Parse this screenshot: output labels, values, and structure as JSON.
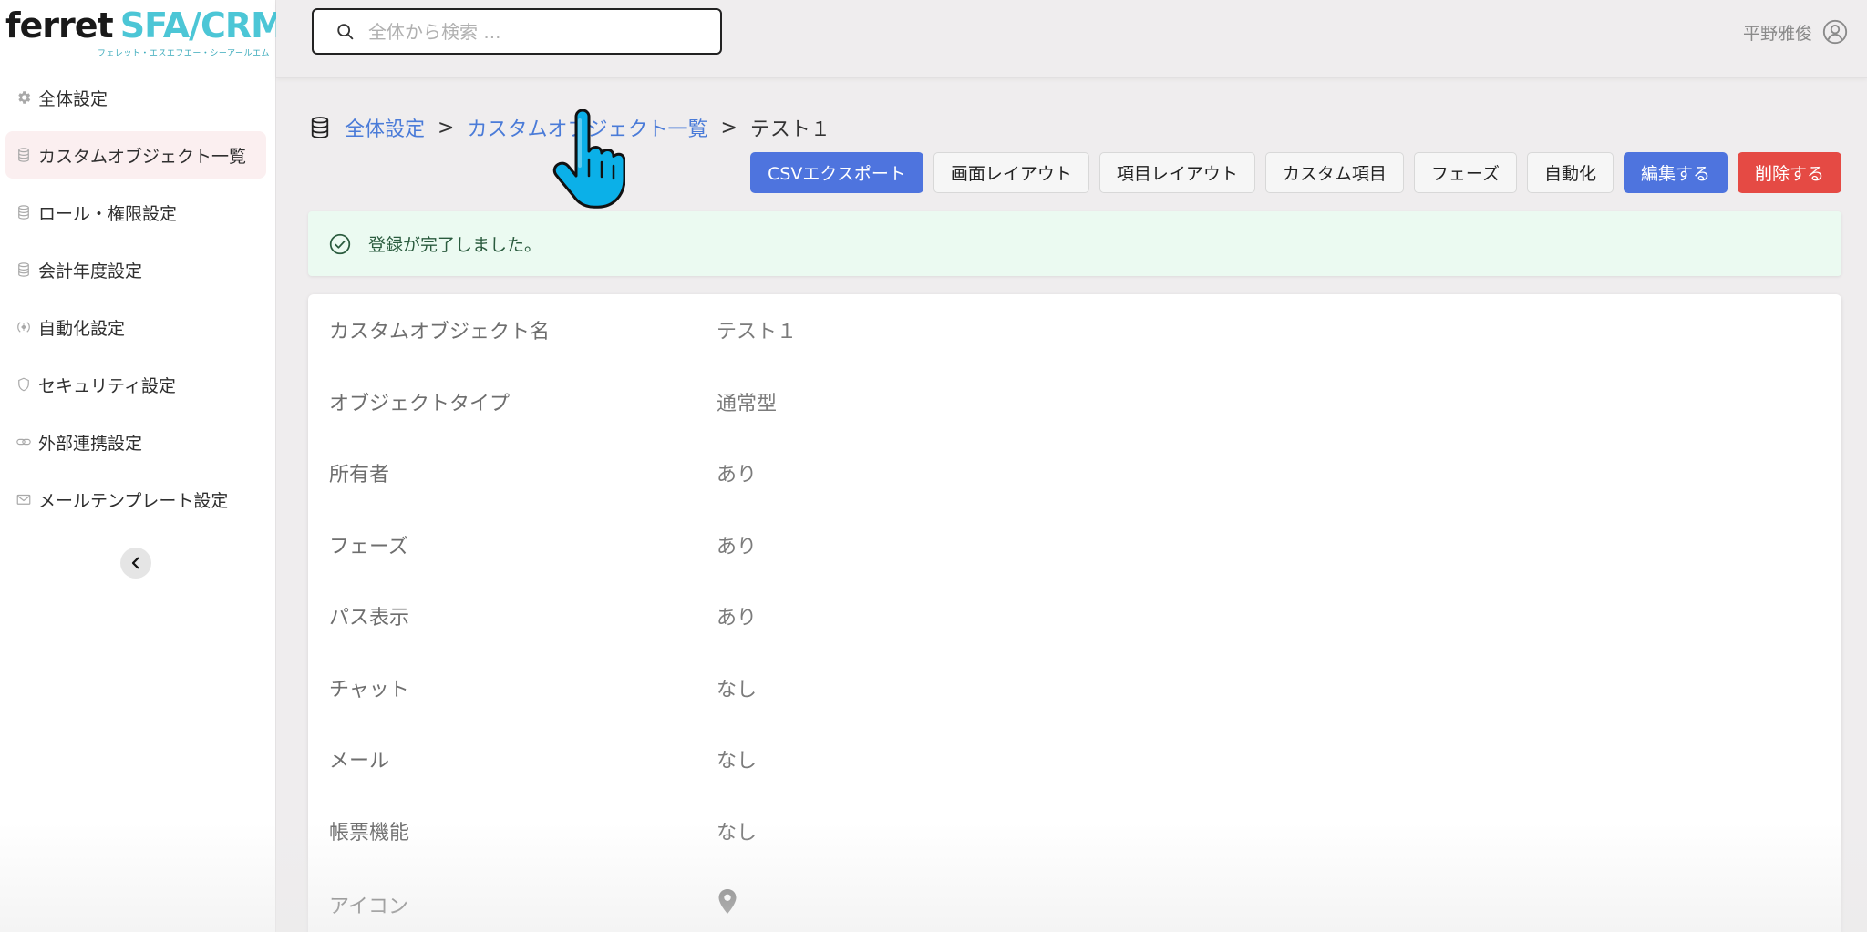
{
  "logo": {
    "brand_ferret": "ferret",
    "brand_product": "SFA/CRM",
    "reading": "フェレット・エスエフエー・シーアールエム"
  },
  "sidebar": {
    "items": [
      {
        "label": "全体設定",
        "icon": "gear-icon"
      },
      {
        "label": "カスタムオブジェクト一覧",
        "icon": "database-icon",
        "active": true
      },
      {
        "label": "ロール・権限設定",
        "icon": "database-icon"
      },
      {
        "label": "会計年度設定",
        "icon": "database-icon"
      },
      {
        "label": "自動化設定",
        "icon": "automation-icon"
      },
      {
        "label": "セキュリティ設定",
        "icon": "shield-icon"
      },
      {
        "label": "外部連携設定",
        "icon": "link-icon"
      },
      {
        "label": "メールテンプレート設定",
        "icon": "mail-icon"
      }
    ],
    "collapse_icon": "chevron-left-icon"
  },
  "header": {
    "search_placeholder": "全体から検索 ...",
    "user_name": "平野雅俊"
  },
  "breadcrumb": {
    "root": "全体設定",
    "parent": "カスタムオブジェクト一覧",
    "current": "テスト１",
    "separator": ">"
  },
  "toolbar": {
    "csv_export": "CSVエクスポート",
    "screen_layout": "画面レイアウト",
    "item_layout": "項目レイアウト",
    "custom_items": "カスタム項目",
    "phase": "フェーズ",
    "automation": "自動化",
    "edit": "編集する",
    "delete": "削除する"
  },
  "alert": {
    "message": "登録が完了しました。",
    "color": "#ebfaf1"
  },
  "details": [
    {
      "label": "カスタムオブジェクト名",
      "value": "テスト１"
    },
    {
      "label": "オブジェクトタイプ",
      "value": "通常型"
    },
    {
      "label": "所有者",
      "value": "あり"
    },
    {
      "label": "フェーズ",
      "value": "あり"
    },
    {
      "label": "パス表示",
      "value": "あり"
    },
    {
      "label": "チャット",
      "value": "なし"
    },
    {
      "label": "メール",
      "value": "なし"
    },
    {
      "label": "帳票機能",
      "value": "なし"
    },
    {
      "label": "アイコン",
      "value_icon": "map-pin-icon"
    }
  ],
  "colors": {
    "primary": "#4e74de",
    "danger": "#e54a44",
    "link": "#4a7bd8",
    "brand_accent": "#4cc6d6"
  }
}
